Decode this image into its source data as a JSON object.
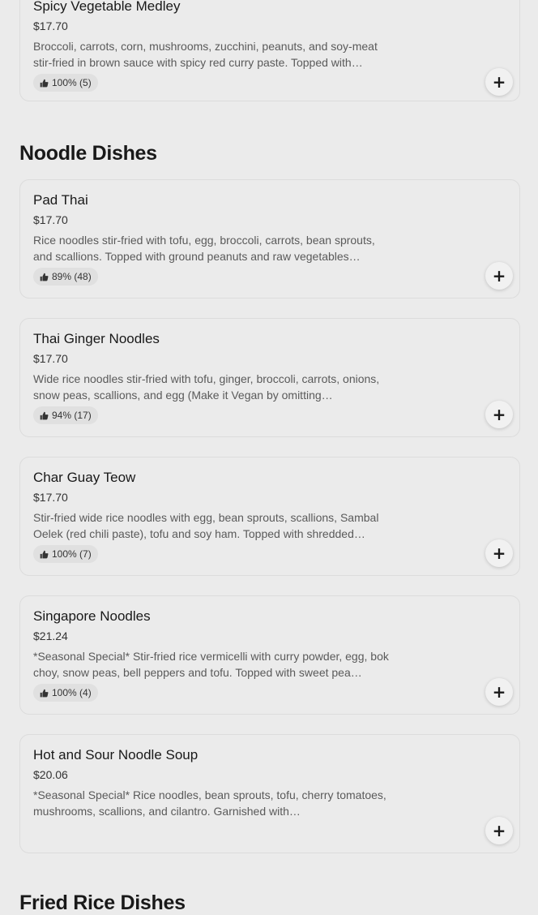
{
  "top_item": {
    "name": "Spicy Vegetable Medley",
    "price": "$17.70",
    "description": "Broccoli, carrots, corn, mushrooms, zucchini, peanuts, and soy-meat stir-fried in brown sauce with spicy red curry paste. Topped with…",
    "rating": "100% (5)"
  },
  "sections": [
    {
      "title": "Noodle Dishes",
      "items": [
        {
          "name": "Pad Thai",
          "price": "$17.70",
          "description": "Rice noodles stir-fried with tofu, egg, broccoli, carrots, bean sprouts, and scallions. Topped with ground peanuts and raw vegetables…",
          "rating": "89% (48)"
        },
        {
          "name": "Thai Ginger Noodles",
          "price": "$17.70",
          "description": "Wide rice noodles stir-fried with tofu, ginger, broccoli, carrots, onions, snow peas, scallions, and egg (Make it Vegan by omitting…",
          "rating": "94% (17)"
        },
        {
          "name": "Char Guay Teow",
          "price": "$17.70",
          "description": "Stir-fried wide rice noodles with egg, bean sprouts, scallions, Sambal Oelek (red chili paste), tofu and soy ham. Topped with shredded…",
          "rating": "100% (7)"
        },
        {
          "name": "Singapore Noodles",
          "price": "$21.24",
          "description": "*Seasonal Special* Stir-fried rice vermicelli with curry powder, egg, bok choy, snow peas, bell peppers and tofu. Topped with sweet pea…",
          "rating": "100% (4)"
        },
        {
          "name": "Hot and Sour Noodle Soup",
          "price": "$20.06",
          "description": "*Seasonal Special* Rice noodles, bean sprouts, tofu, cherry tomatoes, mushrooms, scallions, and cilantro. Garnished with…",
          "rating": ""
        }
      ]
    },
    {
      "title": "Fried Rice Dishes",
      "items": []
    }
  ],
  "icons": {
    "rating": "thumbs-up-icon",
    "add": "plus-icon"
  },
  "add_symbol": "+"
}
